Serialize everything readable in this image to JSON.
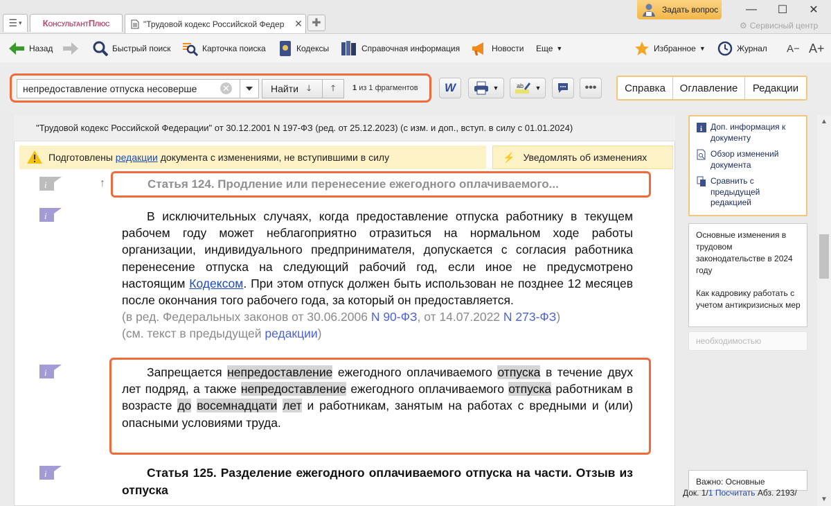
{
  "titlebar": {
    "logo": "КонсультантПлюс",
    "tab_title": "\"Трудовой кодекс Российской Федер",
    "ask_button": "Задать вопрос",
    "service_center": "Сервисный центр"
  },
  "toolbar": {
    "back": "Назад",
    "quick_search": "Быстрый поиск",
    "search_card": "Карточка поиска",
    "codes": "Кодексы",
    "reference": "Справочная информация",
    "news": "Новости",
    "more": "Еще",
    "favorites": "Избранное",
    "journal": "Журнал",
    "font_decrease": "A−",
    "font_increase": "A+"
  },
  "search": {
    "query": "непредоставление отпуска несоверше",
    "find_label": "Найти",
    "fragments_count": "1",
    "fragments_text": "из 1 фрагментов"
  },
  "nav": {
    "help": "Справка",
    "contents": "Оглавление",
    "revisions": "Редакции"
  },
  "document": {
    "header": "\"Трудовой кодекс Российской Федерации\" от 30.12.2001 N 197-ФЗ (ред. от 25.12.2023) (с изм. и доп., вступ. в силу с 01.01.2024)",
    "notice_pre": "Подготовлены ",
    "notice_link": "редакции",
    "notice_post": " документа с изменениями, не вступившими в силу",
    "notify_button": "Уведомлять об изменениях",
    "article_124_title": "Статья 124. Продление или перенесение ежегодного оплачиваемого...",
    "para1_pre": "В исключительных случаях, когда предоставление отпуска работнику в текущем рабочем году может неблагоприятно отразиться на нормальном ходе работы организации, индивидуального предпринимателя, допускается с согласия работника перенесение отпуска на следующий рабочий год, если иное не предусмотрено настоящим ",
    "para1_link": "Кодексом",
    "para1_post": ". При этом отпуск должен быть использован не позднее 12 месяцев после окончания того рабочего года, за который он предоставляется.",
    "edition_pre": "(в ред. Федеральных законов от 30.06.2006 ",
    "edition_law1": "N 90-ФЗ",
    "edition_mid": ", от 14.07.2022 ",
    "edition_law2": "N 273-ФЗ",
    "edition_post": ")",
    "prev_text_pre": "(см. текст в предыдущей ",
    "prev_text_link": "редакции",
    "prev_text_post": ")",
    "p2": {
      "t1": "Запрещается ",
      "h1": "непредоставление",
      "t2": " ежегодного оплачиваемого ",
      "h2": "отпуска",
      "t3": " в течение двух лет подряд, а также ",
      "h3": "непредоставление",
      "t4": " ежегодного оплачиваемого ",
      "h4": "отпуска",
      "t5": " работникам в возрасте ",
      "h5": "до",
      "t6": " ",
      "h6": "восемнадцати",
      "t7": " ",
      "h7": "лет",
      "t8": " и работникам, занятым на работах с вредными и (или) опасными условиями труда."
    },
    "article_125_title": "Статья 125. Разделение ежегодного оплачиваемого отпуска на части. Отзыв из отпуска"
  },
  "sidebar": {
    "doc_info": "Доп. информация к документу",
    "changes_review": "Обзор изменений документа",
    "compare": "Сравнить с предыдущей редакцией",
    "news1": "Основные изменения в трудовом законодательстве в 2024 году",
    "news2": "Как кадровику работать с учетом антикризисных мер",
    "news_faded": "необходимостью",
    "popup": "Важно: Основные"
  },
  "status": {
    "doc_label": "Док. 1/",
    "doc_count_link": "1 Посчитать",
    "para_label": " Абз. 2193/"
  },
  "colors": {
    "accent_frame": "#ef6b3a",
    "nav_border": "#f2c57a",
    "notice_bg": "#fdf2c6",
    "link": "#1a4ac0",
    "logo": "#b44a72"
  }
}
